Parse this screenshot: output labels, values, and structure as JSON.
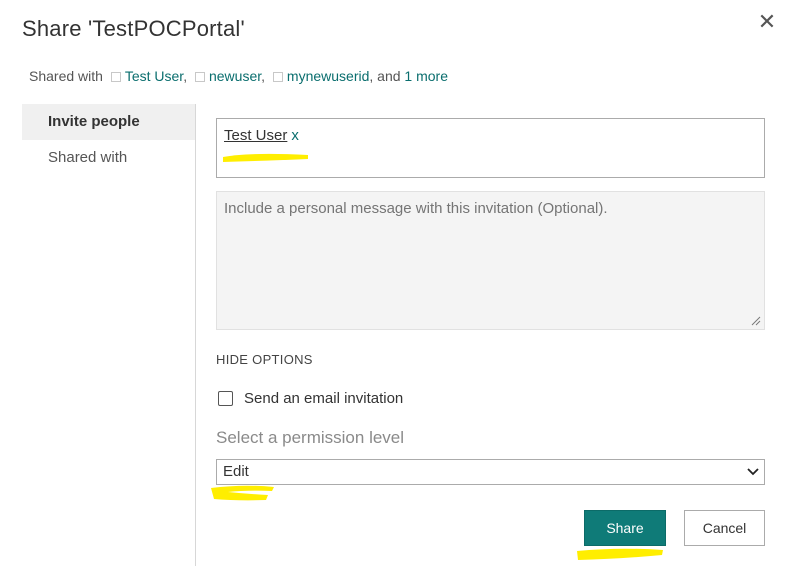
{
  "dialog": {
    "title": "Share 'TestPOCPortal'",
    "close_glyph": "✕"
  },
  "shared_with": {
    "prefix": "Shared with",
    "users": [
      "Test User",
      "newuser",
      "mynewuserid"
    ],
    "separator": ",",
    "and_text": ", and",
    "more_link": "1 more"
  },
  "nav": {
    "items": [
      {
        "label": "Invite people",
        "active": true
      },
      {
        "label": "Shared with",
        "active": false
      }
    ]
  },
  "invite": {
    "people": [
      {
        "name": "Test User",
        "remove": "x"
      }
    ],
    "message_placeholder": "Include a personal message with this invitation (Optional).",
    "hide_options": "HIDE OPTIONS",
    "send_email_label": "Send an email invitation",
    "send_email_checked": false,
    "permission_label": "Select a permission level",
    "permission_value": "Edit"
  },
  "buttons": {
    "share": "Share",
    "cancel": "Cancel"
  },
  "colors": {
    "accent": "#0f7b78",
    "link": "#0a6e6e",
    "highlight": "#ffee00"
  },
  "icons": {
    "close": "close-icon",
    "chevron": "chevron-down-icon",
    "resize": "resize-grip-icon"
  }
}
